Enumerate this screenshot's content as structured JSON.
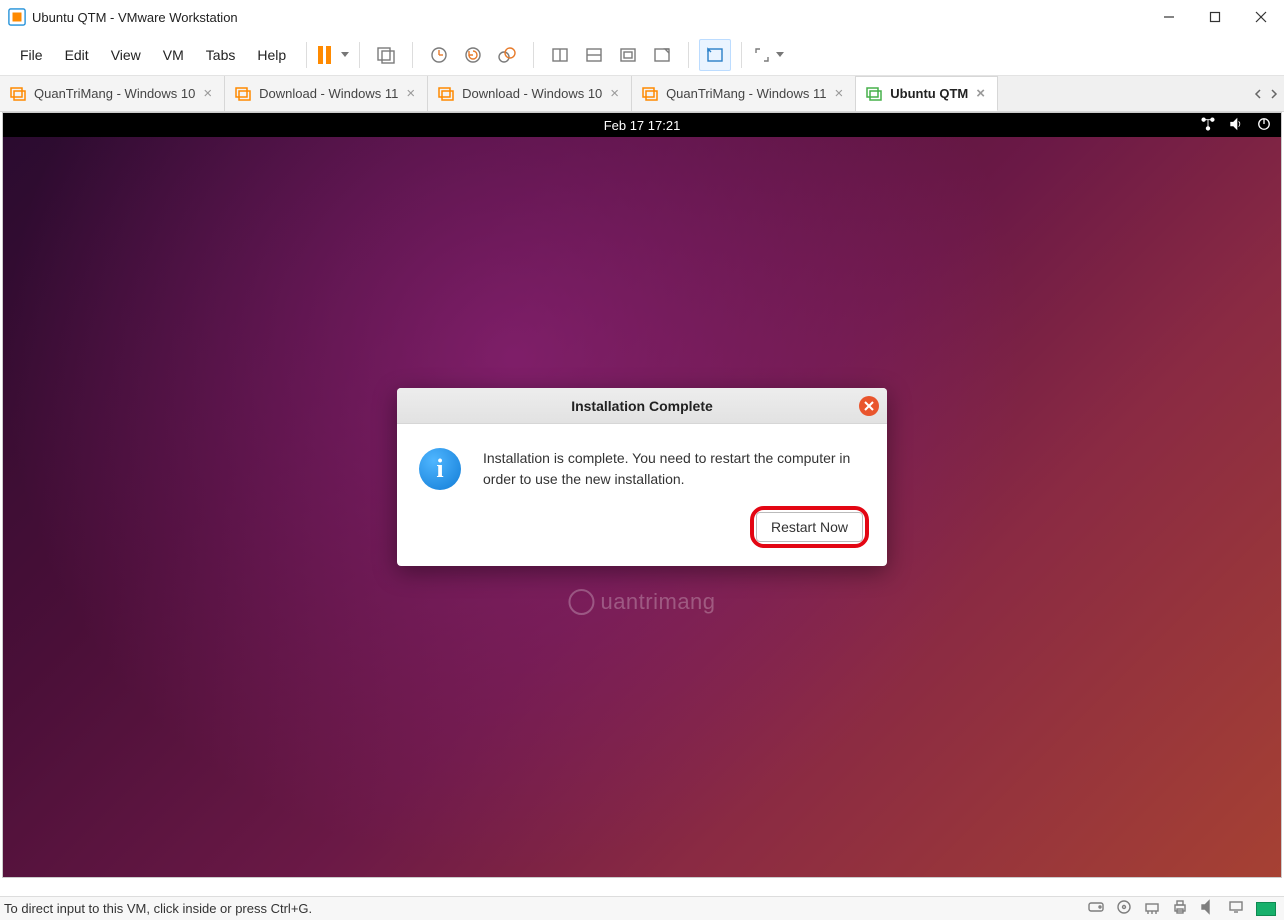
{
  "window": {
    "title": "Ubuntu QTM - VMware Workstation"
  },
  "menu": {
    "items": [
      "File",
      "Edit",
      "View",
      "VM",
      "Tabs",
      "Help"
    ]
  },
  "tabs": {
    "items": [
      {
        "label": "QuanTriMang - Windows 10",
        "active": false
      },
      {
        "label": "Download - Windows 11",
        "active": false
      },
      {
        "label": "Download - Windows 10",
        "active": false
      },
      {
        "label": "QuanTriMang - Windows 11",
        "active": false
      },
      {
        "label": "Ubuntu QTM",
        "active": true
      }
    ]
  },
  "vm": {
    "time": "Feb 17  17:21"
  },
  "dialog": {
    "title": "Installation Complete",
    "message": "Installation is complete. You need to restart the computer in order to use the new installation.",
    "button": "Restart Now"
  },
  "statusbar": {
    "hint": "To direct input to this VM, click inside or press Ctrl+G."
  },
  "watermark": "uantrimang"
}
